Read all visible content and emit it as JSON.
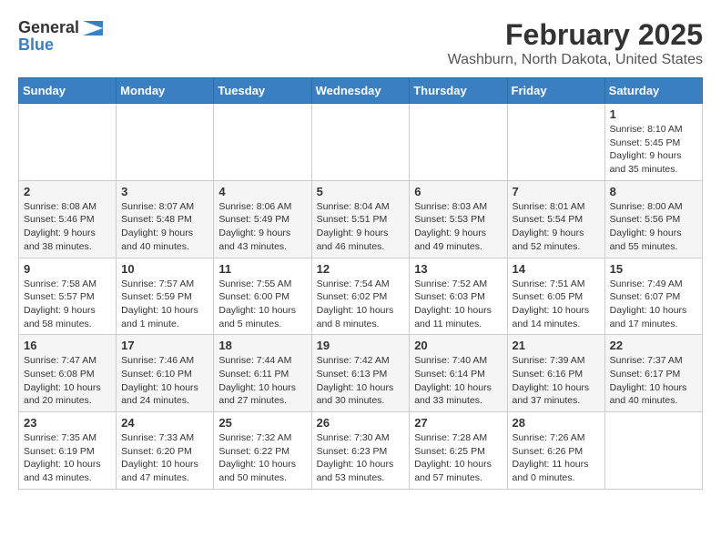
{
  "logo": {
    "general": "General",
    "blue": "Blue"
  },
  "title": "February 2025",
  "subtitle": "Washburn, North Dakota, United States",
  "weekdays": [
    "Sunday",
    "Monday",
    "Tuesday",
    "Wednesday",
    "Thursday",
    "Friday",
    "Saturday"
  ],
  "weeks": [
    [
      {
        "day": "",
        "info": ""
      },
      {
        "day": "",
        "info": ""
      },
      {
        "day": "",
        "info": ""
      },
      {
        "day": "",
        "info": ""
      },
      {
        "day": "",
        "info": ""
      },
      {
        "day": "",
        "info": ""
      },
      {
        "day": "1",
        "info": "Sunrise: 8:10 AM\nSunset: 5:45 PM\nDaylight: 9 hours and 35 minutes."
      }
    ],
    [
      {
        "day": "2",
        "info": "Sunrise: 8:08 AM\nSunset: 5:46 PM\nDaylight: 9 hours and 38 minutes."
      },
      {
        "day": "3",
        "info": "Sunrise: 8:07 AM\nSunset: 5:48 PM\nDaylight: 9 hours and 40 minutes."
      },
      {
        "day": "4",
        "info": "Sunrise: 8:06 AM\nSunset: 5:49 PM\nDaylight: 9 hours and 43 minutes."
      },
      {
        "day": "5",
        "info": "Sunrise: 8:04 AM\nSunset: 5:51 PM\nDaylight: 9 hours and 46 minutes."
      },
      {
        "day": "6",
        "info": "Sunrise: 8:03 AM\nSunset: 5:53 PM\nDaylight: 9 hours and 49 minutes."
      },
      {
        "day": "7",
        "info": "Sunrise: 8:01 AM\nSunset: 5:54 PM\nDaylight: 9 hours and 52 minutes."
      },
      {
        "day": "8",
        "info": "Sunrise: 8:00 AM\nSunset: 5:56 PM\nDaylight: 9 hours and 55 minutes."
      }
    ],
    [
      {
        "day": "9",
        "info": "Sunrise: 7:58 AM\nSunset: 5:57 PM\nDaylight: 9 hours and 58 minutes."
      },
      {
        "day": "10",
        "info": "Sunrise: 7:57 AM\nSunset: 5:59 PM\nDaylight: 10 hours and 1 minute."
      },
      {
        "day": "11",
        "info": "Sunrise: 7:55 AM\nSunset: 6:00 PM\nDaylight: 10 hours and 5 minutes."
      },
      {
        "day": "12",
        "info": "Sunrise: 7:54 AM\nSunset: 6:02 PM\nDaylight: 10 hours and 8 minutes."
      },
      {
        "day": "13",
        "info": "Sunrise: 7:52 AM\nSunset: 6:03 PM\nDaylight: 10 hours and 11 minutes."
      },
      {
        "day": "14",
        "info": "Sunrise: 7:51 AM\nSunset: 6:05 PM\nDaylight: 10 hours and 14 minutes."
      },
      {
        "day": "15",
        "info": "Sunrise: 7:49 AM\nSunset: 6:07 PM\nDaylight: 10 hours and 17 minutes."
      }
    ],
    [
      {
        "day": "16",
        "info": "Sunrise: 7:47 AM\nSunset: 6:08 PM\nDaylight: 10 hours and 20 minutes."
      },
      {
        "day": "17",
        "info": "Sunrise: 7:46 AM\nSunset: 6:10 PM\nDaylight: 10 hours and 24 minutes."
      },
      {
        "day": "18",
        "info": "Sunrise: 7:44 AM\nSunset: 6:11 PM\nDaylight: 10 hours and 27 minutes."
      },
      {
        "day": "19",
        "info": "Sunrise: 7:42 AM\nSunset: 6:13 PM\nDaylight: 10 hours and 30 minutes."
      },
      {
        "day": "20",
        "info": "Sunrise: 7:40 AM\nSunset: 6:14 PM\nDaylight: 10 hours and 33 minutes."
      },
      {
        "day": "21",
        "info": "Sunrise: 7:39 AM\nSunset: 6:16 PM\nDaylight: 10 hours and 37 minutes."
      },
      {
        "day": "22",
        "info": "Sunrise: 7:37 AM\nSunset: 6:17 PM\nDaylight: 10 hours and 40 minutes."
      }
    ],
    [
      {
        "day": "23",
        "info": "Sunrise: 7:35 AM\nSunset: 6:19 PM\nDaylight: 10 hours and 43 minutes."
      },
      {
        "day": "24",
        "info": "Sunrise: 7:33 AM\nSunset: 6:20 PM\nDaylight: 10 hours and 47 minutes."
      },
      {
        "day": "25",
        "info": "Sunrise: 7:32 AM\nSunset: 6:22 PM\nDaylight: 10 hours and 50 minutes."
      },
      {
        "day": "26",
        "info": "Sunrise: 7:30 AM\nSunset: 6:23 PM\nDaylight: 10 hours and 53 minutes."
      },
      {
        "day": "27",
        "info": "Sunrise: 7:28 AM\nSunset: 6:25 PM\nDaylight: 10 hours and 57 minutes."
      },
      {
        "day": "28",
        "info": "Sunrise: 7:26 AM\nSunset: 6:26 PM\nDaylight: 11 hours and 0 minutes."
      },
      {
        "day": "",
        "info": ""
      }
    ]
  ]
}
